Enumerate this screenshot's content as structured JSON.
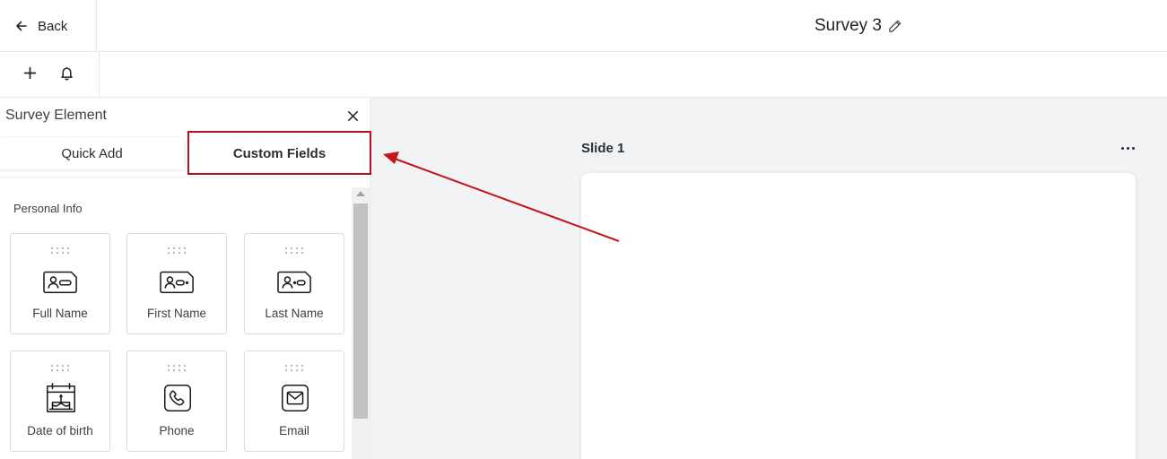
{
  "header": {
    "back_label": "Back",
    "survey_title": "Survey 3"
  },
  "toolbar": {
    "add_icon": "plus-icon",
    "notifications_icon": "bell-icon"
  },
  "panel": {
    "title": "Survey Element",
    "tabs": [
      {
        "label": "Quick Add",
        "active": false
      },
      {
        "label": "Custom Fields",
        "active": true
      }
    ],
    "section_label": "Personal Info",
    "fields": [
      {
        "label": "Full Name",
        "icon": "id-card-icon"
      },
      {
        "label": "First Name",
        "icon": "id-card-icon"
      },
      {
        "label": "Last Name",
        "icon": "id-card-icon"
      },
      {
        "label": "Date of birth",
        "icon": "birthday-cake-icon"
      },
      {
        "label": "Phone",
        "icon": "phone-icon"
      },
      {
        "label": "Email",
        "icon": "mail-icon"
      }
    ]
  },
  "canvas": {
    "slide_label": "Slide 1"
  },
  "colors": {
    "highlight": "#b3121d",
    "canvas_bg": "#f2f3f5"
  }
}
